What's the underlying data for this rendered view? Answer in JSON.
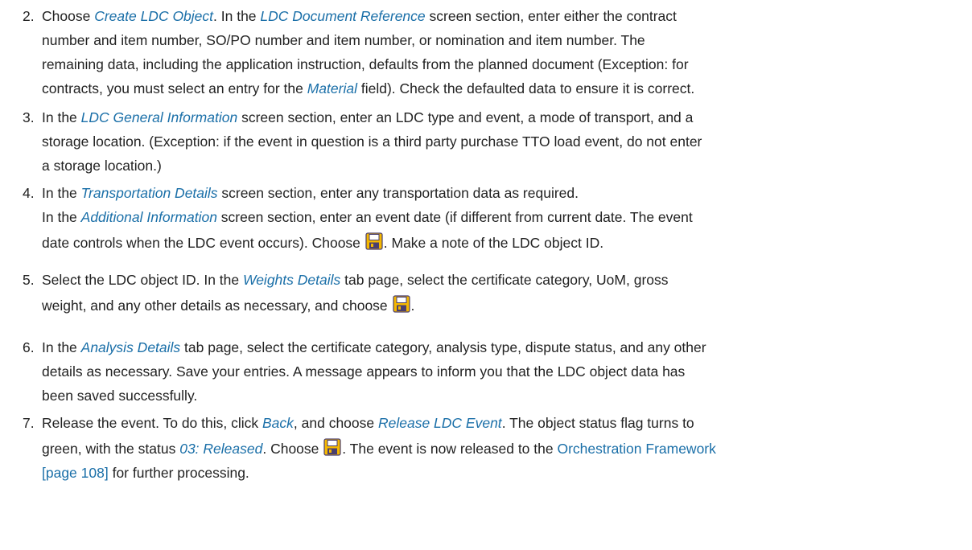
{
  "steps": [
    {
      "number": "2.",
      "lines": [
        [
          {
            "t": "Choose "
          },
          {
            "t": "Create LDC Object",
            "s": "i"
          },
          {
            "t": ". In the "
          },
          {
            "t": "LDC Document Reference",
            "s": "i"
          },
          {
            "t": " screen section, enter either the contract"
          }
        ],
        [
          {
            "t": "number and item number, SO/PO number and item number, or nomination and item number. The"
          }
        ],
        [
          {
            "t": "remaining data, including the application instruction, defaults from the planned document (Exception: for"
          }
        ],
        [
          {
            "t": "contracts, you must select an entry for the "
          },
          {
            "t": "Material",
            "s": "i"
          },
          {
            "t": " field). Check the defaulted data to ensure it is correct."
          }
        ]
      ]
    },
    {
      "number": "3.",
      "lines": [
        [
          {
            "t": "In the "
          },
          {
            "t": "LDC General Information",
            "s": "i"
          },
          {
            "t": " screen section, enter an LDC type and event, a mode of transport, and a"
          }
        ],
        [
          {
            "t": "storage location. (Exception: if the event in question is a third party purchase TTO load event, do not enter"
          }
        ],
        [
          {
            "t": "a storage location.)"
          }
        ]
      ]
    },
    {
      "number": "4.",
      "lines": [
        [
          {
            "t": "In the "
          },
          {
            "t": "Transportation Details",
            "s": "i"
          },
          {
            "t": " screen section, enter any transportation data as required."
          }
        ],
        [
          {
            "t": "In the "
          },
          {
            "t": "Additional Information",
            "s": "i"
          },
          {
            "t": " screen section, enter an event date (if different from current date. The event"
          }
        ],
        [
          {
            "t": "date controls when the LDC event occurs). Choose "
          },
          {
            "icon": "save-icon"
          },
          {
            "t": ". Make a note of the LDC object ID."
          }
        ]
      ]
    },
    {
      "number": "5.",
      "lines": [
        [
          {
            "t": "Select the LDC object ID. In the "
          },
          {
            "t": "Weights Details",
            "s": "i"
          },
          {
            "t": " tab page, select the certificate category, UoM, gross"
          }
        ],
        [
          {
            "t": "weight, and any other details as necessary, and choose "
          },
          {
            "icon": "save-icon"
          },
          {
            "t": "."
          }
        ]
      ]
    },
    {
      "number": "6.",
      "lines": [
        [
          {
            "t": "In the "
          },
          {
            "t": "Analysis Details",
            "s": "i"
          },
          {
            "t": " tab page, select the certificate category, analysis type, dispute status, and any other"
          }
        ],
        [
          {
            "t": "details as necessary. Save your entries. A message appears to inform you that the LDC object data has"
          }
        ],
        [
          {
            "t": "been saved successfully."
          }
        ]
      ]
    },
    {
      "number": "7.",
      "lines": [
        [
          {
            "t": "Release the event. To do this, click "
          },
          {
            "t": "Back",
            "s": "i"
          },
          {
            "t": ", and choose "
          },
          {
            "t": "Release LDC Event",
            "s": "i"
          },
          {
            "t": ". The object status flag turns to"
          }
        ],
        [
          {
            "t": "green, with the status "
          },
          {
            "t": "03: Released",
            "s": "i"
          },
          {
            "t": ". Choose "
          },
          {
            "icon": "save-icon"
          },
          {
            "t": ". The event is now released to the "
          },
          {
            "t": "Orchestration Framework",
            "s": "l"
          }
        ],
        [
          {
            "t": "[page 108]",
            "s": "l"
          },
          {
            "t": " for further processing."
          }
        ]
      ]
    }
  ],
  "colors": {
    "text": "#222222",
    "link": "#1a6fa8",
    "icon_fill": "#f5b800",
    "icon_detail": "#4a3f6e"
  }
}
